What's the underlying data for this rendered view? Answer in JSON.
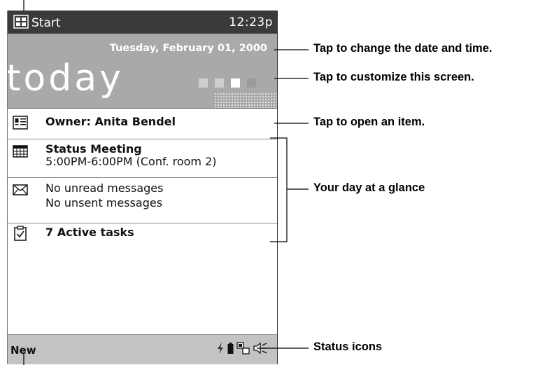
{
  "titlebar": {
    "start_label": "Start",
    "clock": "12:23p"
  },
  "banner": {
    "date": "Tuesday, February 01, 2000",
    "today_label": "today"
  },
  "items": {
    "owner": "Owner: Anita Bendel",
    "meeting_title": "Status Meeting",
    "meeting_detail": "5:00PM-6:00PM (Conf. room 2)",
    "unread": "No unread messages",
    "unsent": "No unsent messages",
    "tasks": "7 Active tasks"
  },
  "bottombar": {
    "new_label": "New"
  },
  "callouts": {
    "date_time": "Tap to change the date and time.",
    "customize": "Tap to customize this screen.",
    "open_item": "Tap to open an item.",
    "day_glance": "Your day at a glance",
    "status_icons": "Status icons"
  },
  "icons": {
    "start": "start-flag-icon",
    "owner": "owner-card-icon",
    "calendar": "calendar-icon",
    "inbox": "envelope-icon",
    "tasks": "clipboard-check-icon",
    "status": [
      "signal-icon",
      "battery-icon",
      "connectivity-icon",
      "speaker-icon"
    ]
  }
}
